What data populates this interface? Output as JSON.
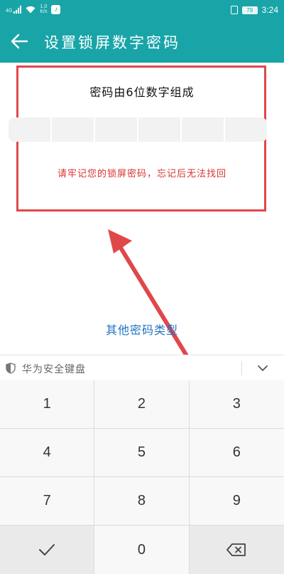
{
  "status_bar": {
    "network_type": "4G",
    "data_speed_value": "1.0",
    "data_speed_unit": "K/s",
    "battery_level": "79",
    "time": "3:24",
    "app_icon": "tiktok-icon"
  },
  "app_bar": {
    "title": "设置锁屏数字密码",
    "back_icon": "back-arrow-icon"
  },
  "password_panel": {
    "title": "密码由6位数字组成",
    "digit_count": 6,
    "warning": "请牢记您的锁屏密码，忘记后无法找回"
  },
  "other_types_link": "其他密码类型",
  "keyboard": {
    "label": "华为安全键盘",
    "shield_icon": "shield-icon",
    "collapse_icon": "chevron-down-icon",
    "keys": [
      "1",
      "2",
      "3",
      "4",
      "5",
      "6",
      "7",
      "8",
      "9",
      "",
      "0",
      ""
    ],
    "confirm_icon": "checkmark-icon",
    "delete_icon": "backspace-icon"
  },
  "colors": {
    "accent": "#19a5a8",
    "annotation_red": "#e0474a",
    "warning_text": "#d9322f",
    "link_blue": "#1f74c4"
  }
}
